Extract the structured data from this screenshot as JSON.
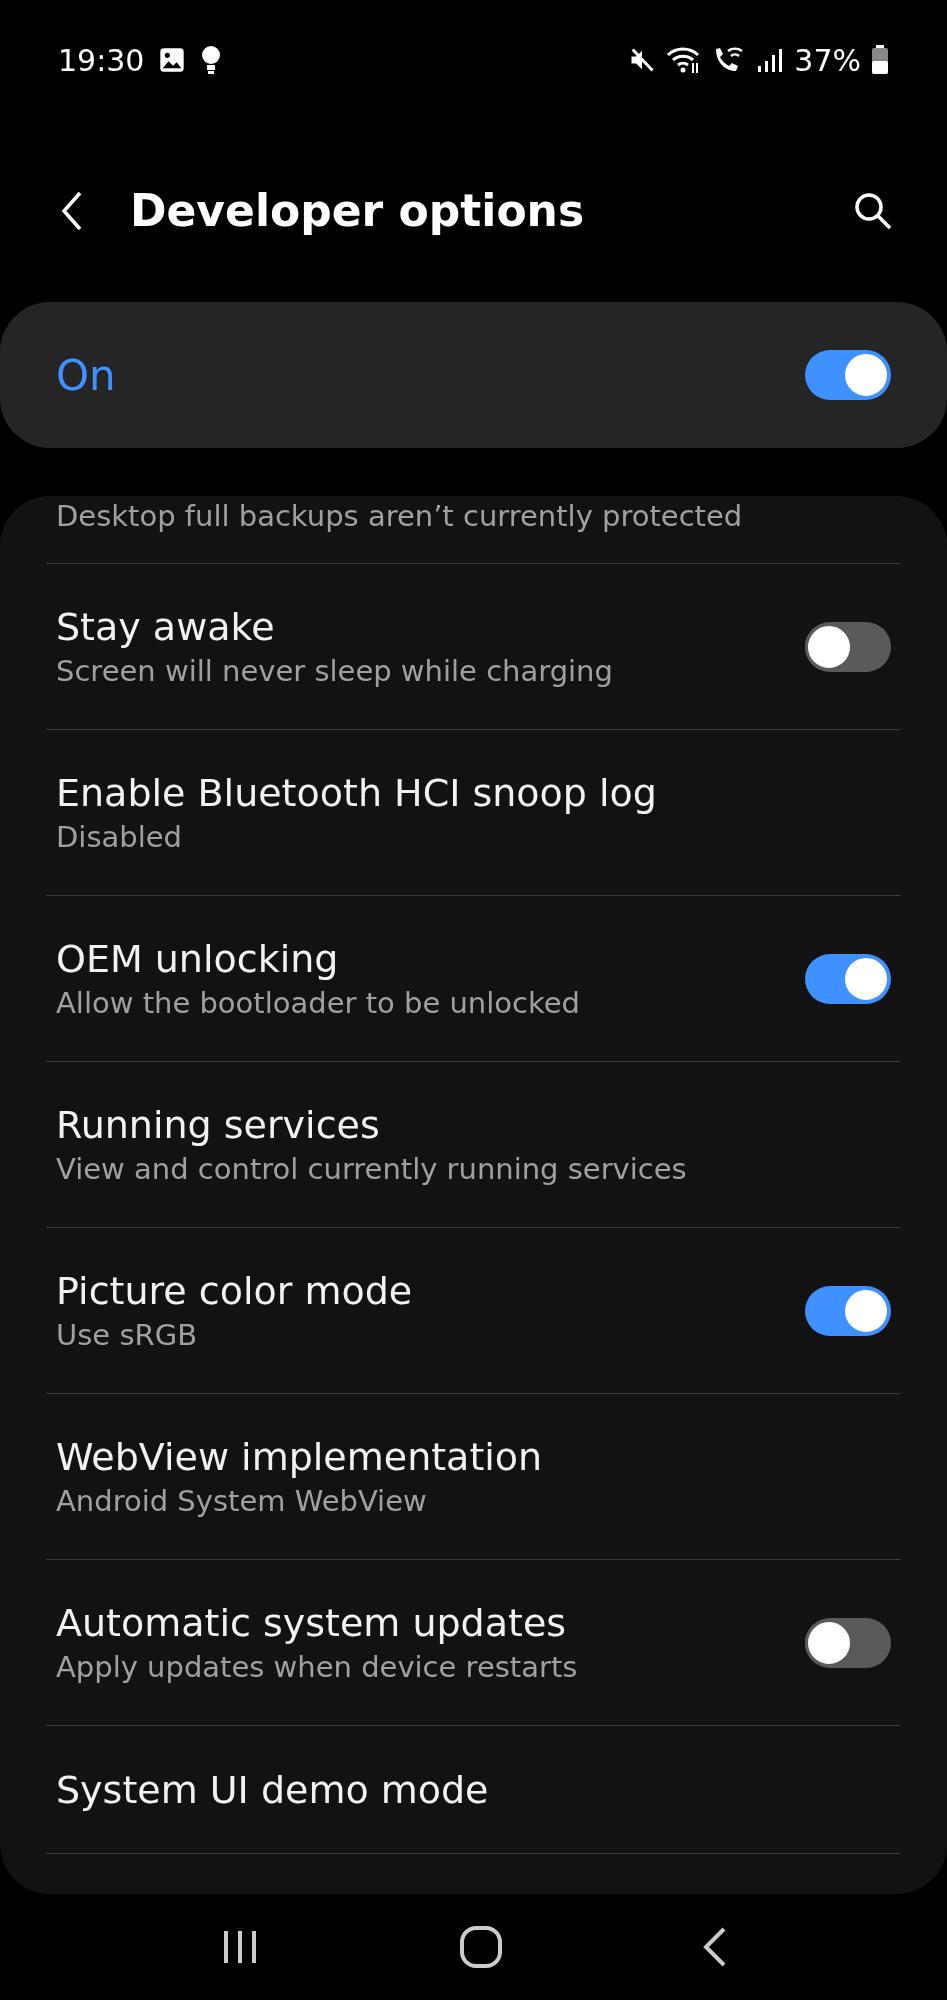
{
  "status_bar": {
    "time": "19:30",
    "battery": "37%"
  },
  "header": {
    "title": "Developer options"
  },
  "master": {
    "label": "On",
    "on": true
  },
  "partial_row": {
    "subtitle": "Desktop full backups aren’t currently protected"
  },
  "rows": [
    {
      "kind": "toggle",
      "title": "Stay awake",
      "subtitle": "Screen will never sleep while charging",
      "on": false
    },
    {
      "kind": "plain",
      "title": "Enable Bluetooth HCI snoop log",
      "subtitle": "Disabled"
    },
    {
      "kind": "toggle",
      "title": "OEM unlocking",
      "subtitle": "Allow the bootloader to be unlocked",
      "on": true
    },
    {
      "kind": "plain",
      "title": "Running services",
      "subtitle": "View and control currently running services"
    },
    {
      "kind": "toggle",
      "title": "Picture color mode",
      "subtitle": "Use sRGB",
      "on": true
    },
    {
      "kind": "plain",
      "title": "WebView implementation",
      "subtitle": "Android System WebView"
    },
    {
      "kind": "toggle",
      "title": "Automatic system updates",
      "subtitle": "Apply updates when device restarts",
      "on": false
    },
    {
      "kind": "plain",
      "title": "System UI demo mode"
    }
  ]
}
